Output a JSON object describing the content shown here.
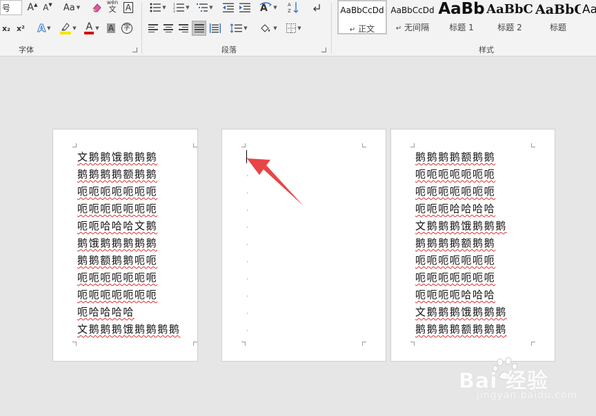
{
  "font_group": {
    "label": "字体",
    "size_label_partial": "号",
    "grow_font_label": "A",
    "shrink_font_label": "A",
    "change_case_label": "Aa",
    "pinyin_top": "wén",
    "pinyin_bottom": "文",
    "char_border_label": "A",
    "subscript_label": "x₂",
    "superscript_label": "x²",
    "text_effect_label": "A",
    "font_color_label": "A",
    "char_shading_label": "A",
    "enclose_char_label": "字"
  },
  "paragraph_group": {
    "label": "段落"
  },
  "styles_group": {
    "label": "样式",
    "items": [
      {
        "sample": "AaBbCcDd",
        "name": "正文",
        "marker": "↵"
      },
      {
        "sample": "AaBbCcDd",
        "name": "无间隔",
        "marker": "↵"
      },
      {
        "sample": "AaBb",
        "name": "标题 1"
      },
      {
        "sample": "AaBbC",
        "name": "标题 2"
      },
      {
        "sample": "AaBbC",
        "name": "标题"
      },
      {
        "sample": "AaB",
        "name": ""
      }
    ]
  },
  "pages": {
    "left": [
      "文鹅鹅饿鹅鹅鹅",
      "鹅鹅鹅鹅额鹅鹅",
      "呃呃呃呃呃呃呃",
      "呃呃呃呃呃呃呃",
      "呃呃哈哈哈文鹅",
      "鹅饿鹅鹅鹅鹅鹅",
      "鹅鹅额鹅鹅呃呃",
      "呃呃呃呃呃呃呃",
      "呃呃呃呃呃呃呃",
      "呃哈哈哈哈",
      "文鹅鹅鹅饿鹅鹅鹅鹅"
    ],
    "middle_marks": [
      "·",
      "·",
      "·",
      "·",
      "·",
      "·",
      "·",
      "·",
      "·",
      "·",
      "·"
    ],
    "right": [
      "鹅鹅鹅鹅额鹅鹅",
      "呃呃呃呃呃呃呃",
      "呃呃呃呃呃呃呃",
      "呃呃呃哈哈哈哈",
      "文鹅鹅鹅饿鹅鹅鹅",
      "鹅鹅鹅鹅额鹅鹅",
      "呃呃呃呃呃呃呃",
      "呃呃呃呃呃呃呃",
      "呃呃呃呃哈哈哈",
      "文鹅鹅鹅饿鹅鹅鹅",
      "鹅鹅鹅鹅额鹅鹅鹅"
    ]
  },
  "watermark": {
    "main": "Bai 经验",
    "sub": "jingyan.baidu.com"
  },
  "colors": {
    "arrow": "#e84545",
    "highlight": "#f5e400",
    "font_color": "#d40000",
    "squiggle": "#d83030"
  }
}
